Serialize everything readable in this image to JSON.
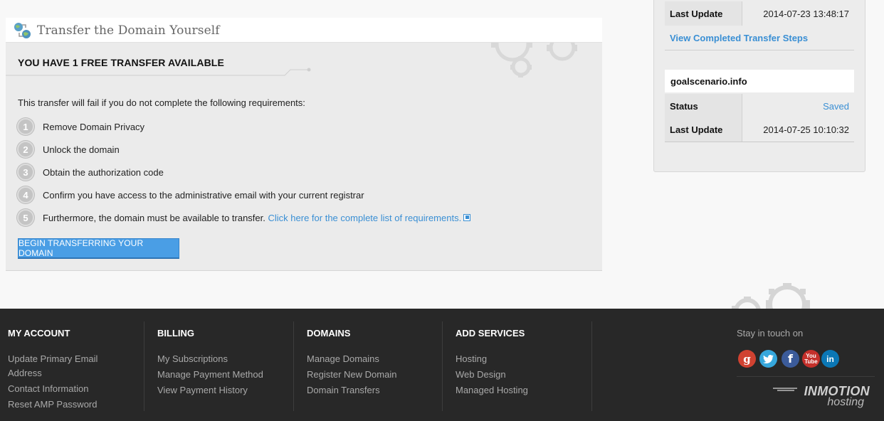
{
  "transfer": {
    "title": "Transfer the Domain Yourself",
    "free_heading": "YOU HAVE 1 FREE TRANSFER AVAILABLE",
    "intro": "This transfer will fail if you do not complete the following requirements:",
    "requirements": [
      {
        "num": "1",
        "text": "Remove Domain Privacy"
      },
      {
        "num": "2",
        "text": "Unlock the domain"
      },
      {
        "num": "3",
        "text": "Obtain the authorization code"
      },
      {
        "num": "4",
        "text": "Confirm you have access to the administrative email with your current registrar"
      },
      {
        "num": "5",
        "text": "Furthermore, the domain must be available to transfer.",
        "link": "Click here for the complete list of requirements."
      }
    ],
    "button_label": "BEGIN TRANSFERRING YOUR DOMAIN"
  },
  "sidebar": {
    "first": {
      "last_update_label": "Last Update",
      "last_update_value": "2014-07-23 13:48:17"
    },
    "view_steps_link": "View Completed Transfer Steps",
    "second": {
      "domain": "goalscenario.info",
      "status_label": "Status",
      "status_value": "Saved",
      "last_update_label": "Last Update",
      "last_update_value": "2014-07-25 10:10:32"
    },
    "accent_color": "#3a8fd4"
  },
  "footer": {
    "columns": [
      {
        "heading": "MY ACCOUNT",
        "links": [
          "Update Primary Email",
          "Address",
          "Contact Information",
          "Reset AMP Password"
        ]
      },
      {
        "heading": "BILLING",
        "links": [
          "My Subscriptions",
          "Manage Payment Method",
          "View Payment History"
        ]
      },
      {
        "heading": "DOMAINS",
        "links": [
          "Manage Domains",
          "Register New Domain",
          "Domain Transfers"
        ]
      },
      {
        "heading": "ADD SERVICES",
        "links": [
          "Hosting",
          "Web Design",
          "Managed Hosting"
        ]
      }
    ],
    "stay_in_touch": "Stay in touch on",
    "social": [
      {
        "icon": "google-plus-icon",
        "glyph": "g"
      },
      {
        "icon": "twitter-icon",
        "glyph": "t"
      },
      {
        "icon": "facebook-icon",
        "glyph": "f"
      },
      {
        "icon": "youtube-icon",
        "glyph_top": "You",
        "glyph_bottom": "Tube"
      },
      {
        "icon": "linkedin-icon",
        "glyph": "in"
      }
    ],
    "logo": {
      "brand": "INMOTION",
      "sub": "hosting"
    }
  }
}
